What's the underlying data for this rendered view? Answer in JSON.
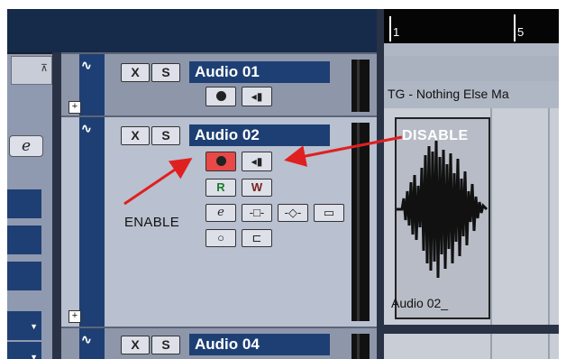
{
  "tracks": [
    {
      "name": "Audio 01",
      "mute": "X",
      "solo": "S"
    },
    {
      "name": "Audio 02",
      "mute": "X",
      "solo": "S",
      "read": "R",
      "write": "W",
      "edit_icon": "e"
    },
    {
      "name": "Audio 04",
      "mute": "X",
      "solo": "S"
    }
  ],
  "annotations": {
    "enable": "ENABLE",
    "disable": "DISABLE"
  },
  "inspector": {
    "edit_icon": "e"
  },
  "ruler": {
    "markers": [
      "1",
      "5"
    ]
  },
  "arrange": {
    "tg_part": "TG - Nothing Else Ma",
    "clip_label": "Audio 02_"
  },
  "colors": {
    "arrow": "#e02020",
    "track_name_bg": "#1e3f73",
    "record_on": "#e84848"
  },
  "icons": [
    "audio-track-icon",
    "record-icon",
    "monitor-icon",
    "read-icon",
    "write-icon",
    "edit-icon",
    "lane-icon",
    "folder-icon"
  ]
}
